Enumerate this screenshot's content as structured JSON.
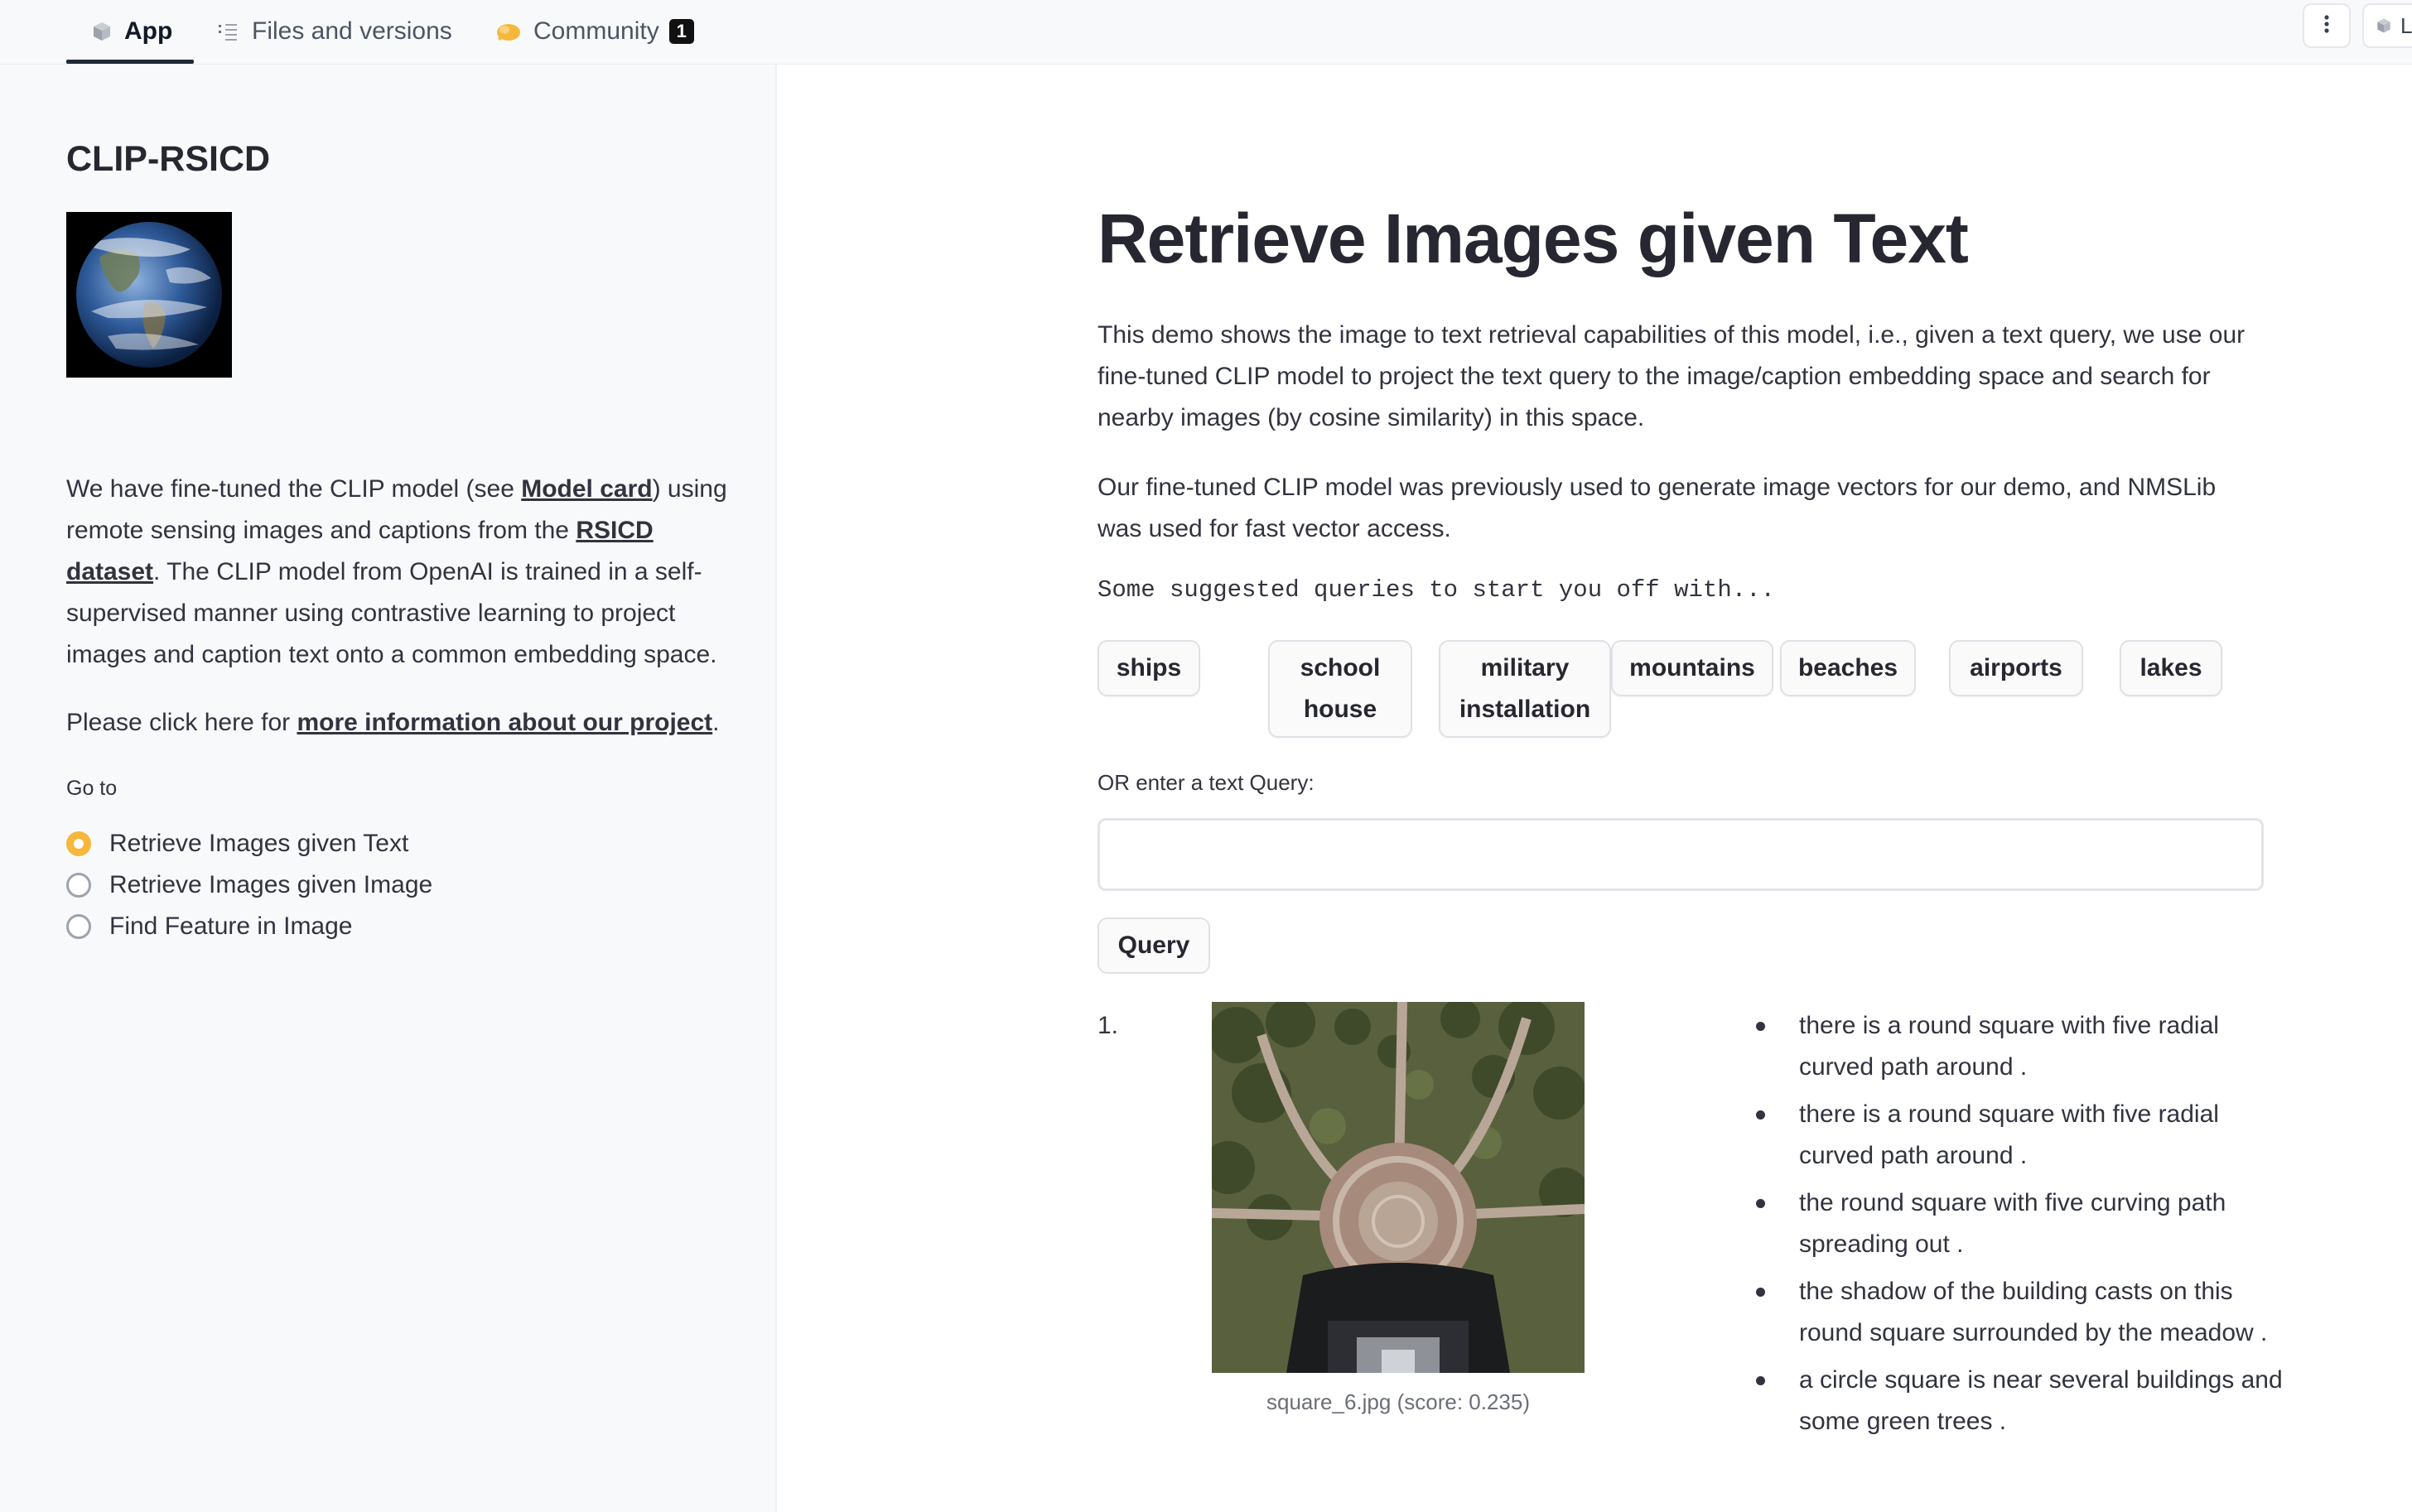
{
  "tabs": [
    {
      "label": "App",
      "icon": "cube-icon",
      "active": true
    },
    {
      "label": "Files and versions",
      "icon": "files-icon",
      "active": false
    },
    {
      "label": "Community",
      "icon": "community-icon",
      "active": false,
      "badge": "1"
    }
  ],
  "topbar_right": {
    "menu_icon": "more-vert-icon",
    "chip_text": "L"
  },
  "sidebar": {
    "title": "CLIP-RSICD",
    "image_alt": "Earth globe",
    "para1": {
      "t1": "We have fine-tuned the CLIP model (see ",
      "link1": "Model card",
      "t2": ") using remote sensing images and captions from the ",
      "link2": "RSICD dataset",
      "t3": ". The CLIP model from OpenAI is trained in a self-supervised manner using contrastive learning to project images and caption text onto a common embedding space."
    },
    "para2": {
      "t1": "Please click here for ",
      "link": "more information about our project",
      "t2": "."
    },
    "goto_label": "Go to",
    "radio_options": [
      {
        "label": "Retrieve Images given Text",
        "selected": true
      },
      {
        "label": "Retrieve Images given Image",
        "selected": false
      },
      {
        "label": "Find Feature in Image",
        "selected": false
      }
    ]
  },
  "main": {
    "title": "Retrieve Images given Text",
    "para1": "This demo shows the image to text retrieval capabilities of this model, i.e., given a text query, we use our fine-tuned CLIP model to project the text query to the image/caption embedding space and search for nearby images (by cosine similarity) in this space.",
    "para2": "Our fine-tuned CLIP model was previously used to generate image vectors for our demo, and NMSLib was used for fast vector access.",
    "suggest_label": "Some suggested queries to start you off with...",
    "suggestions": [
      "ships",
      "school\nhouse",
      "military\ninstallation",
      "mountains",
      "beaches",
      "airports",
      "lakes"
    ],
    "query_label": "OR enter a text Query:",
    "query_value": "",
    "query_button": "Query",
    "result": {
      "index": "1.",
      "caption": "square_6.jpg (score: 0.235)",
      "descriptions": [
        "there is a round square with five radial curved path around .",
        "there is a round square with five radial curved path around .",
        "the round square with five curving path spreading out .",
        "the shadow of the building casts on this round square surrounded by the meadow .",
        "a circle square is near several buildings and some green trees ."
      ]
    }
  },
  "colors": {
    "accent_radio": "#f6b73c",
    "text": "#31333f",
    "sidebar_bg": "#f8f9fb"
  }
}
